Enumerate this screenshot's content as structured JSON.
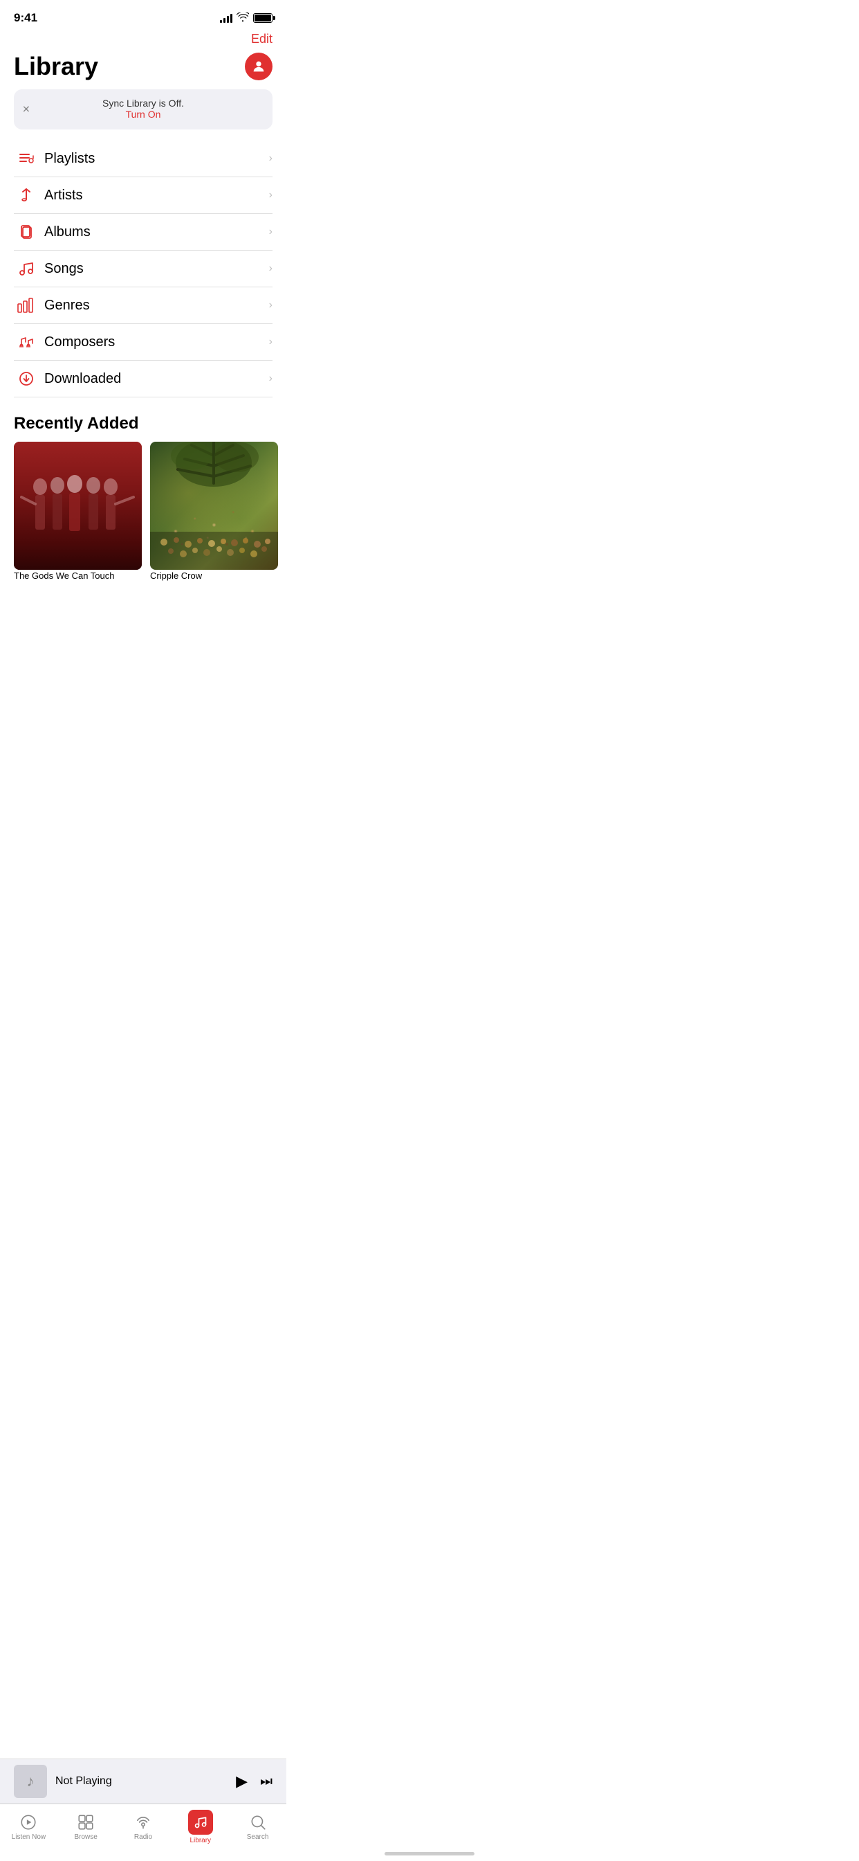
{
  "statusBar": {
    "time": "9:41"
  },
  "header": {
    "editLabel": "Edit"
  },
  "title": {
    "pageTitle": "Library"
  },
  "syncBanner": {
    "message": "Sync Library is Off.",
    "actionLabel": "Turn On"
  },
  "libraryItems": [
    {
      "id": "playlists",
      "label": "Playlists",
      "icon": "playlists-icon"
    },
    {
      "id": "artists",
      "label": "Artists",
      "icon": "artists-icon"
    },
    {
      "id": "albums",
      "label": "Albums",
      "icon": "albums-icon"
    },
    {
      "id": "songs",
      "label": "Songs",
      "icon": "songs-icon"
    },
    {
      "id": "genres",
      "label": "Genres",
      "icon": "genres-icon"
    },
    {
      "id": "composers",
      "label": "Composers",
      "icon": "composers-icon"
    },
    {
      "id": "downloaded",
      "label": "Downloaded",
      "icon": "downloaded-icon"
    }
  ],
  "recentlyAdded": {
    "sectionTitle": "Recently Added",
    "albums": [
      {
        "id": "album1",
        "name": "The Gods We Can Touch",
        "type": "gods"
      },
      {
        "id": "album2",
        "name": "Cripple Crow",
        "type": "cripple"
      }
    ]
  },
  "miniPlayer": {
    "title": "Not Playing",
    "playIcon": "▶",
    "skipIcon": "⏭"
  },
  "tabBar": {
    "tabs": [
      {
        "id": "listen-now",
        "label": "Listen Now",
        "icon": "play-circle-icon",
        "active": false
      },
      {
        "id": "browse",
        "label": "Browse",
        "icon": "browse-icon",
        "active": false
      },
      {
        "id": "radio",
        "label": "Radio",
        "icon": "radio-icon",
        "active": false
      },
      {
        "id": "library",
        "label": "Library",
        "icon": "library-icon",
        "active": true
      },
      {
        "id": "search",
        "label": "Search",
        "icon": "search-icon",
        "active": false
      }
    ]
  }
}
